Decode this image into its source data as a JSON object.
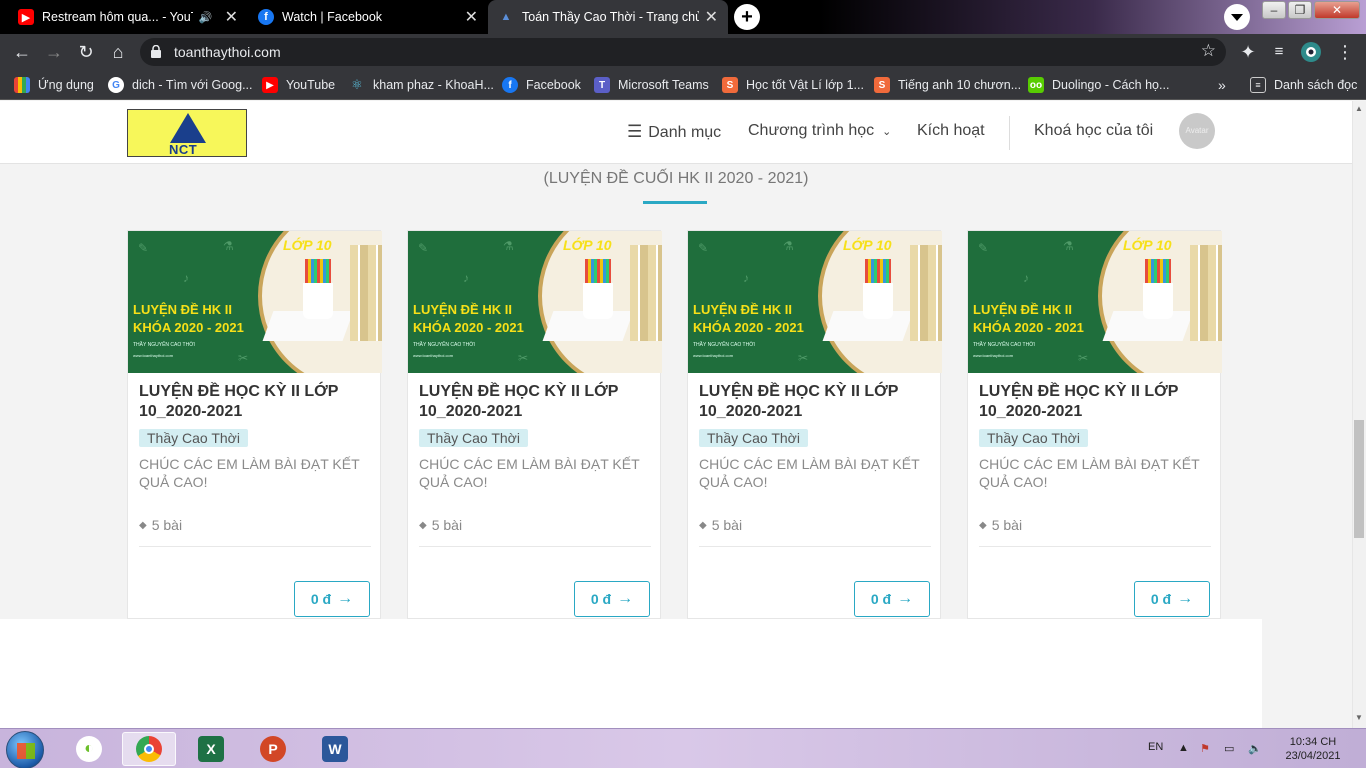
{
  "browser": {
    "tabs": [
      {
        "title": "Restream hôm qua... - YouTu",
        "favicon": "youtube-icon"
      },
      {
        "title": "Watch | Facebook",
        "favicon": "facebook-icon"
      },
      {
        "title": "Toán Thầy Cao Thời - Trang chủ",
        "favicon": "site-icon"
      }
    ],
    "new_tab_label": "+",
    "url": "toanthaythoi.com",
    "bookmarks": [
      {
        "label": "Ứng dụng",
        "icon": "apps-grid-icon"
      },
      {
        "label": "dich - Tìm với Goog...",
        "icon": "google-icon"
      },
      {
        "label": "YouTube",
        "icon": "youtube-icon"
      },
      {
        "label": "kham phaz - KhoaH...",
        "icon": "atom-icon"
      },
      {
        "label": "Facebook",
        "icon": "facebook-icon"
      },
      {
        "label": "Microsoft Teams",
        "icon": "teams-icon"
      },
      {
        "label": "Học tốt Vật Lí lớp 1...",
        "icon": "sachgiai-icon"
      },
      {
        "label": "Tiếng anh 10 chươn...",
        "icon": "sachgiai-icon"
      },
      {
        "label": "Duolingo - Cách họ...",
        "icon": "duolingo-icon"
      }
    ],
    "bookmarks_more": "»",
    "reading_list": "Danh sách đọc"
  },
  "site": {
    "logo_text": "NCT",
    "menu": {
      "categories": "Danh mục",
      "programs": "Chương trình học",
      "activate": "Kích hoạt",
      "my_courses": "Khoá học của tôi",
      "avatar": "Avatar"
    },
    "section_subtitle": "(LUYỆN ĐỀ CUỐI HK II 2020 - 2021)",
    "thumb": {
      "grade": "LỚP 10",
      "line1": "LUYỆN ĐỀ HK II",
      "line2": "KHÓA 2020 - 2021",
      "teacher": "THẦY NGUYỄN CAO THỜI",
      "site": "www.toanthaythoi.com"
    },
    "courses": [
      {
        "title": "LUYỆN ĐỀ HỌC KỲ II LỚP 10_2020-2021",
        "teacher": "Thầy Cao Thời",
        "desc": "CHÚC CÁC EM LÀM BÀI ĐẠT KẾT QUẢ CAO!",
        "lessons": "5 bài",
        "price": "0 đ"
      },
      {
        "title": "LUYỆN ĐỀ HỌC KỲ II LỚP 10_2020-2021",
        "teacher": "Thầy Cao Thời",
        "desc": "CHÚC CÁC EM LÀM BÀI ĐẠT KẾT QUẢ CAO!",
        "lessons": "5 bài",
        "price": "0 đ"
      },
      {
        "title": "LUYỆN ĐỀ HỌC KỲ II LỚP 10_2020-2021",
        "teacher": "Thầy Cao Thời",
        "desc": "CHÚC CÁC EM LÀM BÀI ĐẠT KẾT QUẢ CAO!",
        "lessons": "5 bài",
        "price": "0 đ"
      },
      {
        "title": "LUYỆN ĐỀ HỌC KỲ II LỚP 10_2020-2021",
        "teacher": "Thầy Cao Thời",
        "desc": "CHÚC CÁC EM LÀM BÀI ĐẠT KẾT QUẢ CAO!",
        "lessons": "5 bài",
        "price": "0 đ"
      }
    ]
  },
  "taskbar": {
    "apps": [
      "chrome-icon",
      "excel-icon",
      "powerpoint-icon",
      "word-icon"
    ],
    "lang": "EN",
    "time": "10:34 CH",
    "date": "23/04/2021"
  },
  "colors": {
    "accent": "#2aa8c4",
    "thumb_green": "#1f6e3c",
    "thumb_yellow": "#f7e018",
    "teacher_badge": "#d4eef2"
  }
}
